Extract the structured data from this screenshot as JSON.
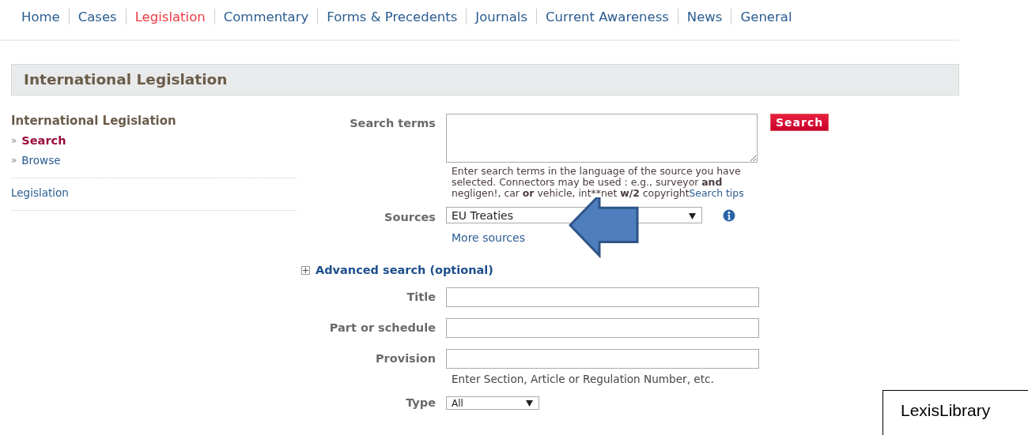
{
  "nav": [
    {
      "label": "Home",
      "selected": false
    },
    {
      "label": "Cases",
      "selected": false
    },
    {
      "label": "Legislation",
      "selected": true
    },
    {
      "label": "Commentary",
      "selected": false
    },
    {
      "label": "Forms & Precedents",
      "selected": false
    },
    {
      "label": "Journals",
      "selected": false
    },
    {
      "label": "Current Awareness",
      "selected": false
    },
    {
      "label": "News",
      "selected": false
    },
    {
      "label": "General",
      "selected": false
    }
  ],
  "page_title": "International Legislation",
  "sidebar": {
    "heading": "International Legislation",
    "links": [
      {
        "marker": "»",
        "label": "Search",
        "selected": true
      },
      {
        "marker": "»",
        "label": "Browse",
        "selected": false
      }
    ],
    "items": [
      {
        "label": "Legislation"
      }
    ]
  },
  "form": {
    "search_terms": {
      "label": "Search terms"
    },
    "search_button": "Search",
    "help": [
      {
        "text": "Enter search terms in the language of the source you have selected. Connectors may be used : e.g., surveyor ",
        "bold": false
      },
      {
        "text": "and",
        "bold": true
      },
      {
        "text": " negligen!, car ",
        "bold": false
      },
      {
        "text": "or",
        "bold": true
      },
      {
        "text": " vehicle, int**net ",
        "bold": false
      },
      {
        "text": "w/2",
        "bold": true
      },
      {
        "text": " copyright",
        "bold": false
      }
    ],
    "help_link": "Search tips",
    "sources": {
      "label": "Sources",
      "value": "EU Treaties"
    },
    "more_sources": "More sources",
    "advanced": {
      "label": "Advanced search (optional)",
      "expanded": false
    },
    "fields": [
      {
        "kind": "text",
        "label": "Title"
      },
      {
        "kind": "text",
        "label": "Part or schedule"
      },
      {
        "kind": "text",
        "label": "Provision",
        "hint": "Enter Section, Article or Regulation Number, etc."
      },
      {
        "kind": "select",
        "label": "Type",
        "value": "All"
      }
    ]
  },
  "callout": {
    "label": "LexisLibrary"
  }
}
